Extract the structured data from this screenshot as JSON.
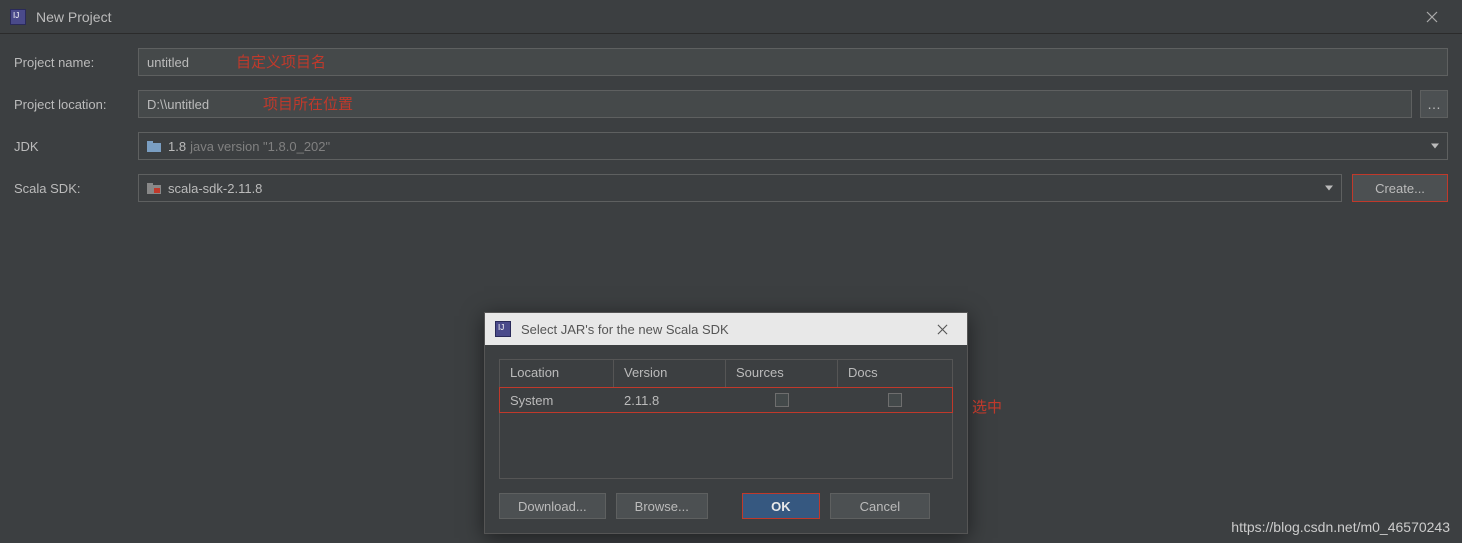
{
  "window": {
    "title": "New Project"
  },
  "form": {
    "project_name": {
      "label": "Project name:",
      "value": "untitled",
      "annotation": "自定义项目名"
    },
    "project_location": {
      "label": "Project location:",
      "value": "D:\\\\untitled",
      "annotation": "项目所在位置"
    },
    "jdk": {
      "label": "JDK",
      "version": "1.8",
      "detail": "java version \"1.8.0_202\""
    },
    "scala_sdk": {
      "label": "Scala SDK:",
      "value": "scala-sdk-2.11.8",
      "create_btn": "Create..."
    }
  },
  "dialog": {
    "title": "Select JAR's for the new Scala SDK",
    "headers": {
      "location": "Location",
      "version": "Version",
      "sources": "Sources",
      "docs": "Docs"
    },
    "row": {
      "location": "System",
      "version": "2.11.8"
    },
    "annotation": "选中",
    "buttons": {
      "download": "Download...",
      "browse": "Browse...",
      "ok": "OK",
      "cancel": "Cancel"
    }
  },
  "watermark": "https://blog.csdn.net/m0_46570243"
}
